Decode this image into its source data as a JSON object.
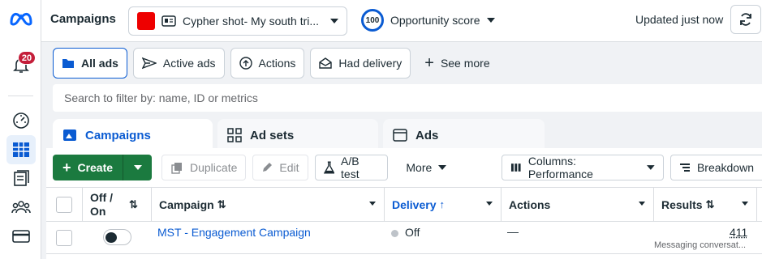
{
  "rail": {
    "notification_count": "20",
    "icons": [
      "meta-logo-icon",
      "bell-icon",
      "dashboard-gauge-icon",
      "table-grid-icon",
      "pages-icon",
      "audience-icon",
      "billing-card-icon"
    ]
  },
  "topbar": {
    "title": "Campaigns",
    "account_name": "Cypher shot- My south tri...",
    "opportunity_score_value": "100",
    "opportunity_score_label": "Opportunity score",
    "updated_text": "Updated just now"
  },
  "filters": {
    "all_ads": "All ads",
    "active_ads": "Active ads",
    "actions": "Actions",
    "had_delivery": "Had delivery",
    "see_more": "See more"
  },
  "search": {
    "placeholder": "Search to filter by: name, ID or metrics"
  },
  "tabs": {
    "campaigns": "Campaigns",
    "ad_sets": "Ad sets",
    "ads": "Ads"
  },
  "toolbar": {
    "create": "Create",
    "duplicate": "Duplicate",
    "edit": "Edit",
    "ab_test": "A/B test",
    "more": "More",
    "columns": "Columns: Performance",
    "breakdown": "Breakdown"
  },
  "table": {
    "headers": {
      "off_on": "Off / On",
      "campaign": "Campaign",
      "delivery": "Delivery",
      "actions": "Actions",
      "results": "Results"
    },
    "rows": [
      {
        "campaign": "MST - Engagement Campaign",
        "delivery": "Off",
        "actions": "—",
        "results": "411",
        "results_sub": "Messaging conversat..."
      }
    ]
  },
  "colors": {
    "accent_blue": "#0a5bd2",
    "create_green": "#1b7a3f",
    "badge_red": "#c41e3a"
  }
}
